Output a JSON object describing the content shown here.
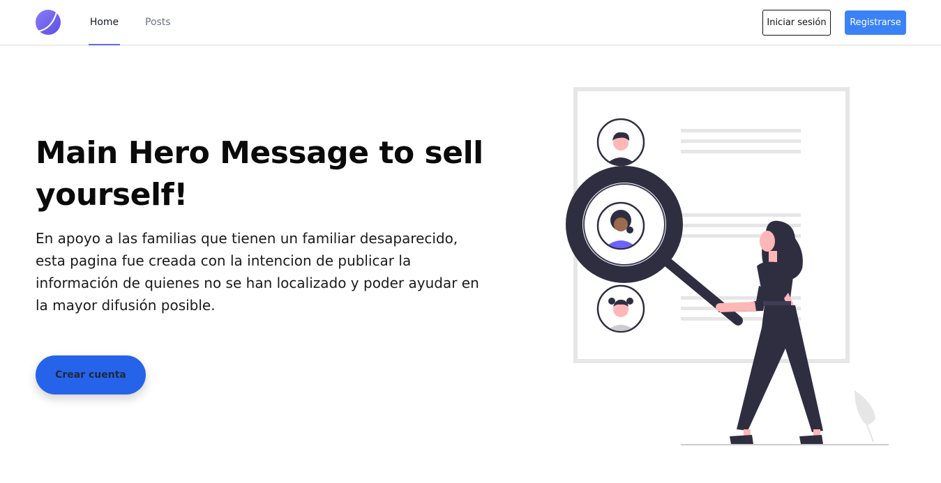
{
  "nav": {
    "home_label": "Home",
    "posts_label": "Posts",
    "login_label": "Iniciar sesión",
    "register_label": "Registrarse"
  },
  "hero": {
    "title": "Main Hero Message to sell yourself!",
    "description": "En apoyo a las familias que tienen un familiar desaparecido, esta pagina fue creada con la intencion de publicar la información de quienes no se han localizado y poder ayudar en la mayor difusión posible.",
    "cta_label": "Crear cuenta"
  },
  "colors": {
    "accent": "#6366f1",
    "primary_blue": "#3b82f6",
    "cta_blue": "#2563eb",
    "illustration_dark": "#2f2e41",
    "illustration_skin": "#ffb6b6",
    "illustration_purple": "#6c63ff"
  },
  "icons": {
    "logo": "logo-icon",
    "illustration": "search-people-illustration"
  }
}
